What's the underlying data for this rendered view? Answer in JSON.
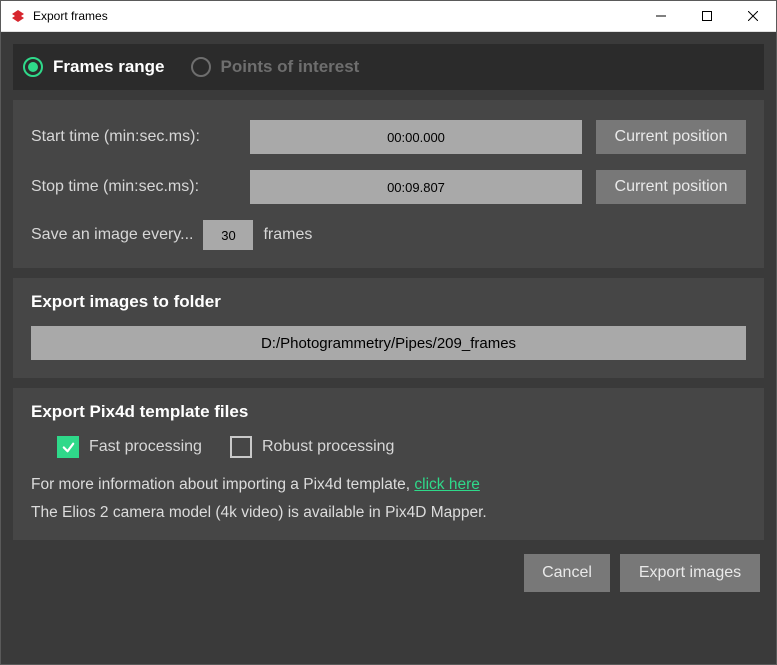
{
  "window": {
    "title": "Export frames"
  },
  "tabs": {
    "frames_range": "Frames range",
    "points_of_interest": "Points of interest"
  },
  "frames": {
    "start_label": "Start time (min:sec.ms):",
    "start_value": "00:00.000",
    "stop_label": "Stop time (min:sec.ms):",
    "stop_value": "00:09.807",
    "current_position_btn": "Current position",
    "save_every_prefix": "Save an image every...",
    "save_every_value": "30",
    "save_every_suffix": "frames"
  },
  "folder": {
    "title": "Export images to folder",
    "path": "D:/Photogrammetry/Pipes/209_frames"
  },
  "pix4d": {
    "title": "Export Pix4d template files",
    "fast_label": "Fast processing",
    "fast_checked": true,
    "robust_label": "Robust processing",
    "robust_checked": false,
    "info_prefix": "For more information about importing a Pix4d template, ",
    "info_link": "click here",
    "camera_note": "The Elios 2 camera model (4k video) is available in Pix4D Mapper."
  },
  "footer": {
    "cancel": "Cancel",
    "export": "Export images"
  }
}
